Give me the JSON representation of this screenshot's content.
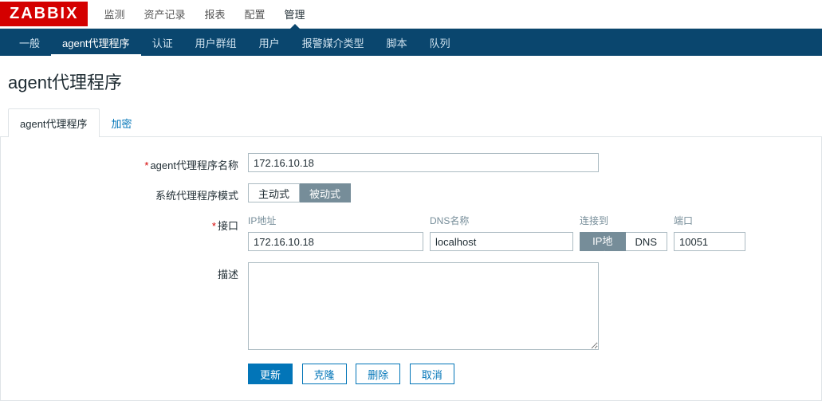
{
  "logo": "ZABBIX",
  "topMenu": [
    "监测",
    "资产记录",
    "报表",
    "配置",
    "管理"
  ],
  "topMenuActiveIndex": 4,
  "subNav": [
    "一般",
    "agent代理程序",
    "认证",
    "用户群组",
    "用户",
    "报警媒介类型",
    "脚本",
    "队列"
  ],
  "subNavActiveIndex": 1,
  "pageTitle": "agent代理程序",
  "tabs": [
    "agent代理程序",
    "加密"
  ],
  "tabsActiveIndex": 0,
  "form": {
    "nameLabel": "agent代理程序名称",
    "nameValue": "172.16.10.18",
    "modeLabel": "系统代理程序模式",
    "modeOptions": [
      "主动式",
      "被动式"
    ],
    "modeActiveIndex": 1,
    "interfaceLabel": "接口",
    "interfaceHeaders": {
      "ip": "IP地址",
      "dns": "DNS名称",
      "connect": "连接到",
      "port": "端口"
    },
    "interface": {
      "ip": "172.16.10.18",
      "dns": "localhost",
      "connectOptions": [
        "IP地址",
        "DNS"
      ],
      "connectActiveIndex": 0,
      "port": "10051"
    },
    "descLabel": "描述",
    "descValue": ""
  },
  "buttons": {
    "update": "更新",
    "clone": "克隆",
    "delete": "删除",
    "cancel": "取消"
  }
}
